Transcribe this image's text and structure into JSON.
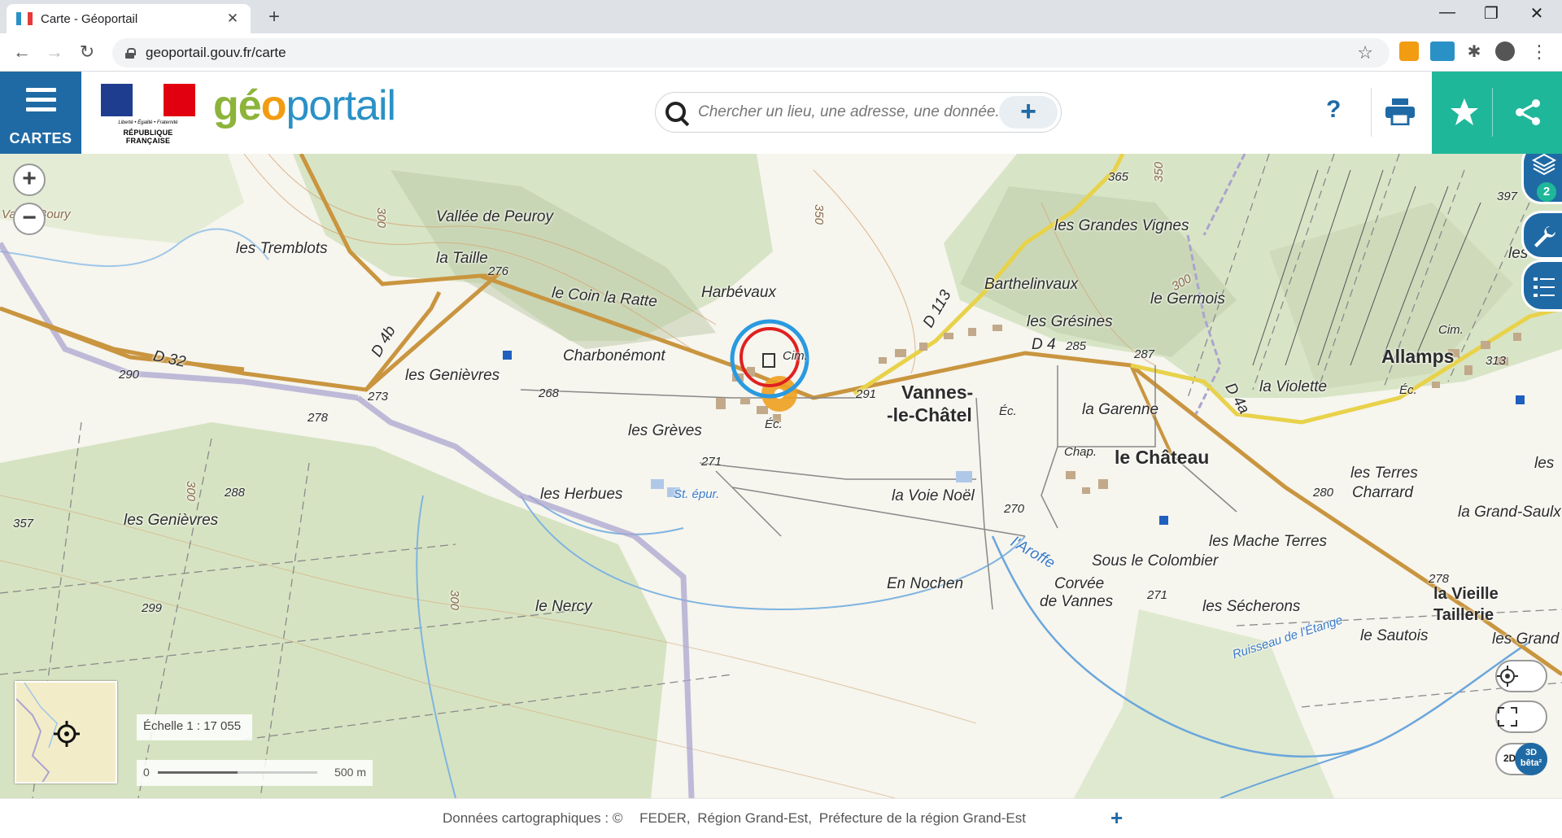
{
  "browser": {
    "tab_title": "Carte - Géoportail",
    "url": "geoportail.gouv.fr/carte",
    "new_tab_symbol": "+",
    "close_symbol": "✕"
  },
  "header": {
    "menu_label": "CARTES",
    "republic_motto": "Liberté • Égalité • Fraternité",
    "republic_name": "RÉPUBLIQUE FRANÇAISE",
    "logo": {
      "part1": "gé",
      "part2": "o",
      "part3": "portail"
    },
    "search_placeholder": "Chercher un lieu, une adresse, une donnée...",
    "search_plus": "+",
    "help_label": "?",
    "colors": {
      "primary": "#1f6aa5",
      "accent": "#1fb79a",
      "logo_green": "#8db43a",
      "logo_orange": "#f29c12",
      "logo_blue": "#2a91c6"
    }
  },
  "map": {
    "zoom_in": "+",
    "zoom_out": "−",
    "layers_badge": "2",
    "scale_text": "Échelle 1 : 17 055",
    "scale_start": "0",
    "scale_end": "500 m",
    "view_2d": "2D",
    "view_3d": "3D",
    "view_3d_sub": "bêta²",
    "labels": [
      {
        "text": "Vallée Boury",
        "kind": "brown"
      },
      {
        "text": "Vallée de Peuroy",
        "kind": "place"
      },
      {
        "text": "les Tremblots",
        "kind": "place"
      },
      {
        "text": "la Taille",
        "kind": "place"
      },
      {
        "text": "276",
        "kind": "small"
      },
      {
        "text": "le Coin la Ratte",
        "kind": "place"
      },
      {
        "text": "Harbévaux",
        "kind": "place"
      },
      {
        "text": "D 4b",
        "kind": "place"
      },
      {
        "text": "D 32",
        "kind": "place"
      },
      {
        "text": "290",
        "kind": "small"
      },
      {
        "text": "Charbonémont",
        "kind": "place"
      },
      {
        "text": "les Genièvres",
        "kind": "place"
      },
      {
        "text": "273",
        "kind": "small"
      },
      {
        "text": "278",
        "kind": "small"
      },
      {
        "text": "268",
        "kind": "small"
      },
      {
        "text": "les Grèves",
        "kind": "place"
      },
      {
        "text": "Éc.",
        "kind": "small"
      },
      {
        "text": "Cim.",
        "kind": "small"
      },
      {
        "text": "291",
        "kind": "small"
      },
      {
        "text": "Vannes-",
        "kind": "town"
      },
      {
        "text": "-le-Châtel",
        "kind": "town"
      },
      {
        "text": "D 113",
        "kind": "place"
      },
      {
        "text": "365",
        "kind": "small"
      },
      {
        "text": "les Grandes Vignes",
        "kind": "place"
      },
      {
        "text": "Barthelinvaux",
        "kind": "place"
      },
      {
        "text": "le Germois",
        "kind": "place"
      },
      {
        "text": "les Grésines",
        "kind": "place"
      },
      {
        "text": "D 4",
        "kind": "place"
      },
      {
        "text": "285",
        "kind": "small"
      },
      {
        "text": "287",
        "kind": "small"
      },
      {
        "text": "la Garenne",
        "kind": "place"
      },
      {
        "text": "Éc.",
        "kind": "small"
      },
      {
        "text": "Chap.",
        "kind": "small"
      },
      {
        "text": "le Château",
        "kind": "town"
      },
      {
        "text": "la Violette",
        "kind": "place"
      },
      {
        "text": "D 4a",
        "kind": "place"
      },
      {
        "text": "Allamps",
        "kind": "town"
      },
      {
        "text": "Cim.",
        "kind": "small"
      },
      {
        "text": "Éc.",
        "kind": "small"
      },
      {
        "text": "313",
        "kind": "small"
      },
      {
        "text": "397",
        "kind": "small"
      },
      {
        "text": "les Tes",
        "kind": "place"
      },
      {
        "text": "les Terres",
        "kind": "place"
      },
      {
        "text": "Charrard",
        "kind": "place"
      },
      {
        "text": "280",
        "kind": "small"
      },
      {
        "text": "la Grand-Saulx",
        "kind": "place"
      },
      {
        "text": "les Mache Terres",
        "kind": "place"
      },
      {
        "text": "Sous le Colombier",
        "kind": "place"
      },
      {
        "text": "l'Aroffe",
        "kind": "water"
      },
      {
        "text": "270",
        "kind": "small"
      },
      {
        "text": "la Voie Noël",
        "kind": "place"
      },
      {
        "text": "271",
        "kind": "small"
      },
      {
        "text": "les Herbues",
        "kind": "place"
      },
      {
        "text": "St. épur.",
        "kind": "water"
      },
      {
        "text": "288",
        "kind": "small"
      },
      {
        "text": "357",
        "kind": "small"
      },
      {
        "text": "les Genièvres",
        "kind": "place"
      },
      {
        "text": "299",
        "kind": "small"
      },
      {
        "text": "le Nercy",
        "kind": "place"
      },
      {
        "text": "En Nochen",
        "kind": "place"
      },
      {
        "text": "Corvée",
        "kind": "place"
      },
      {
        "text": "de Vannes",
        "kind": "place"
      },
      {
        "text": "271",
        "kind": "small"
      },
      {
        "text": "les Sécherons",
        "kind": "place"
      },
      {
        "text": "278",
        "kind": "small"
      },
      {
        "text": "la Vieille",
        "kind": "town"
      },
      {
        "text": "Taillerie",
        "kind": "town"
      },
      {
        "text": "le Sautois",
        "kind": "place"
      },
      {
        "text": "les Grand",
        "kind": "place"
      },
      {
        "text": "Ruisseau de l'Étange",
        "kind": "water"
      },
      {
        "text": "les",
        "kind": "place"
      },
      {
        "text": "350",
        "kind": "brown"
      },
      {
        "text": "300",
        "kind": "brown"
      },
      {
        "text": "350",
        "kind": "brown"
      },
      {
        "text": "300",
        "kind": "brown"
      },
      {
        "text": "300",
        "kind": "brown"
      },
      {
        "text": "300",
        "kind": "brown"
      }
    ]
  },
  "footer": {
    "prefix": "Données cartographiques : ©",
    "credits": [
      "FEDER,",
      "Région Grand-Est,",
      "Préfecture de la région Grand-Est"
    ],
    "plus": "+"
  }
}
